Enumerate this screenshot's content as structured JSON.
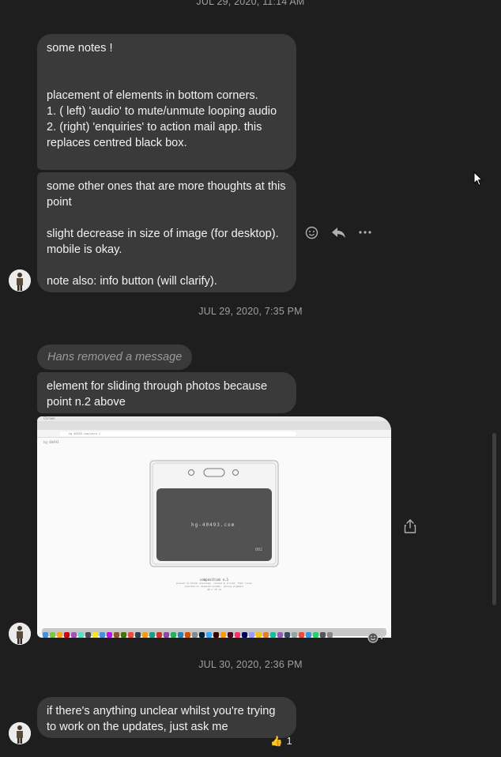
{
  "timestamps": {
    "t0": "JUL 29, 2020, 11:14 AM",
    "t1": "JUL 29, 2020, 7:35 PM",
    "t2": "JUL 30, 2020, 2:36 PM"
  },
  "messages": {
    "m1": "some notes !\n\n\nplacement of elements in bottom corners.\n1. ( left) 'audio' to mute/unmute looping audio\n2. (right) 'enquiries' to action mail app. this replaces centred black box.",
    "m2": "some other ones that are more thoughts at this point\n\nslight decrease in size of image (for desktop). mobile is okay.\n\nnote also: info button (will clarify).",
    "removed": "Hans removed a message",
    "m3": "element for sliding through photos because point n.2 above",
    "m4": "if there's anything unclear whilst you're trying to work on the updates, just ask me"
  },
  "screenshot": {
    "site_label": "hg-40493",
    "card_text": "hg-40493.com",
    "card_corner": "002",
    "caption_title": "composition n.1",
    "caption_line1": "placed on blank envelope, carved & sliced, then lines",
    "caption_line2": "painted on diamond wooden, glossy pigment",
    "caption_line3": "40 x 70 cm",
    "url": "hg-40493.com/work-1",
    "browser_app": "Chrome"
  },
  "reaction": {
    "emoji": "👍",
    "count": "1"
  },
  "icons": {
    "emoji": "smiley-icon",
    "reply": "reply-icon",
    "more": "more-icon",
    "share": "share-icon",
    "add_reaction": "add-reaction-icon"
  }
}
